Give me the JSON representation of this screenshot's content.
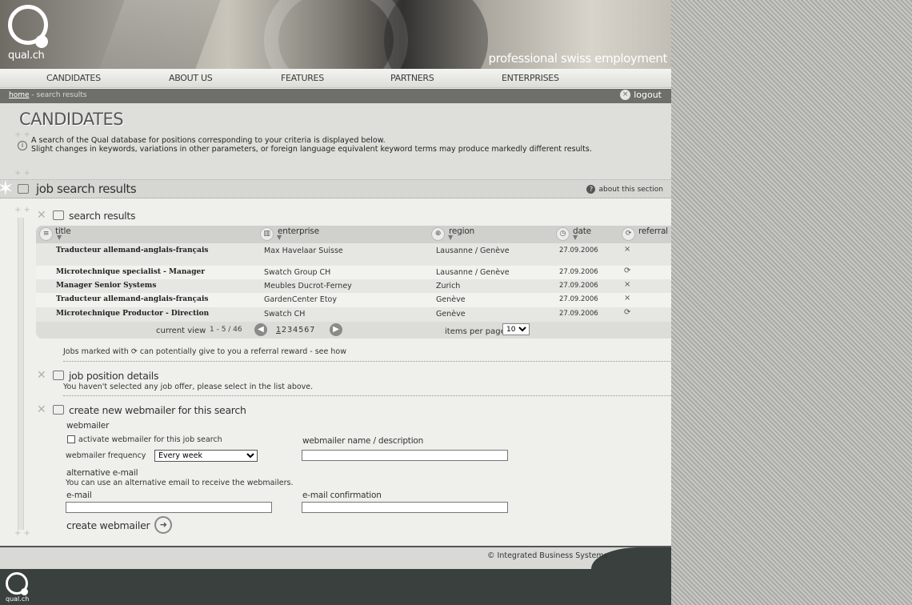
{
  "header": {
    "logo_text": "qual.ch",
    "tagline": "professional swiss employment"
  },
  "nav": [
    "CANDIDATES",
    "ABOUT US",
    "FEATURES",
    "PARTNERS",
    "ENTERPRISES"
  ],
  "breadcrumb": {
    "home": "home",
    "separator": " - ",
    "current": "search results",
    "logout": "logout"
  },
  "intro": {
    "heading": "CANDIDATES",
    "line1": "A search of the Qual database for positions corresponding to your criteria is displayed below.",
    "line2": "Slight changes in keywords, variations in other parameters, or foreign language equivalent keyword terms may produce markedly different results."
  },
  "section": {
    "title": "job search results",
    "about": "about this section"
  },
  "results": {
    "heading": "search results",
    "columns": [
      "title",
      "enterprise",
      "region",
      "date",
      "referral"
    ],
    "rows": [
      {
        "title": "Traducteur allemand-anglais-français",
        "enterprise": "Max Havelaar Suisse",
        "region": "Lausanne / Genève",
        "date": "27.09.2006",
        "referral": "×"
      },
      {
        "title": "Microtechnique specialist - Manager",
        "enterprise": "Swatch Group CH",
        "region": "Lausanne / Genève",
        "date": "27.09.2006",
        "referral": "⟳"
      },
      {
        "title": "Manager Senior Systems",
        "enterprise": "Meubles Ducrot-Ferney",
        "region": "Zurich",
        "date": "27.09.2006",
        "referral": "×"
      },
      {
        "title": "Traducteur allemand-anglais-français",
        "enterprise": "GardenCenter Etoy",
        "region": "Genève",
        "date": "27.09.2006",
        "referral": "×"
      },
      {
        "title": "Microtechnique Productor - Direction",
        "enterprise": "Swatch CH",
        "region": "Genève",
        "date": "27.09.2006",
        "referral": "⟳"
      }
    ],
    "pager": {
      "current_view_label": "current view",
      "range": "1 - 5 / 46",
      "pages": [
        "1",
        "2",
        "3",
        "4",
        "5",
        "6",
        "7"
      ],
      "current_page": "1",
      "items_per_page_label": "items per page",
      "items_per_page": "10"
    },
    "referral_note_before": "Jobs marked with",
    "referral_note_after": "can potentially give to you a referral reward - see how"
  },
  "details": {
    "heading": "job position details",
    "text": "You haven't selected any job offer, please select in the list above."
  },
  "webmailer": {
    "heading": "create new webmailer for this search",
    "sub": "webmailer",
    "activate_label": "activate webmailer for this job search",
    "frequency_label": "webmailer frequency",
    "frequency_value": "Every week",
    "name_label": "webmailer name / description",
    "alt_heading": "alternative e-mail",
    "alt_text": "You can use an alternative email to receive the webmailers.",
    "email_label": "e-mail",
    "email_confirm_label": "e-mail confirmation",
    "create_label": "create webmailer"
  },
  "footer": {
    "copyright": "Integrated Business Systems",
    "logo_text": "qual.ch"
  }
}
